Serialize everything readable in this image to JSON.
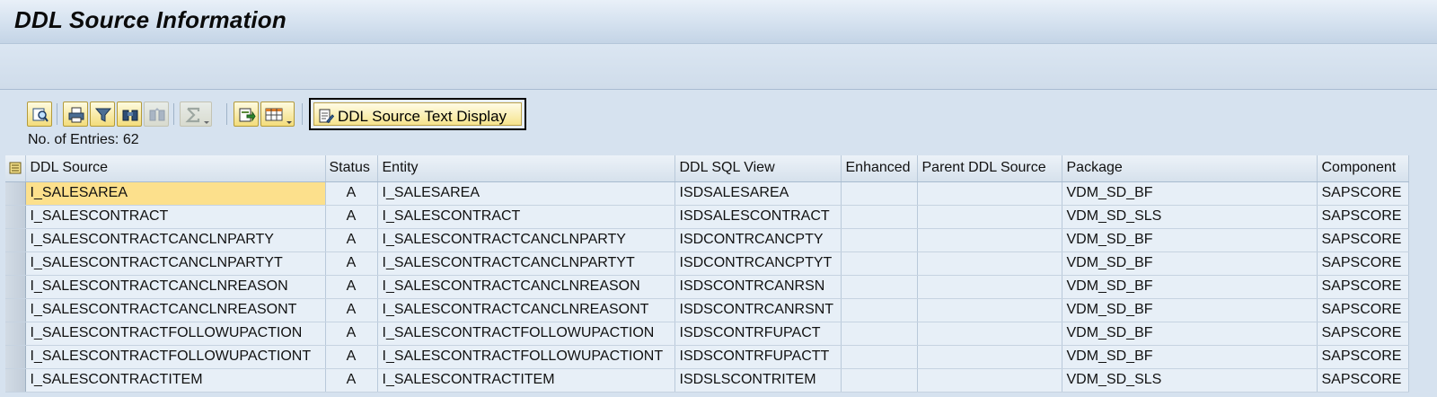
{
  "window": {
    "title": "DDL Source Information"
  },
  "toolbar": {
    "buttons": [
      {
        "name": "details-icon",
        "enabled": true
      },
      {
        "name": "print-icon",
        "enabled": true
      },
      {
        "name": "filter-icon",
        "enabled": true
      },
      {
        "name": "find-icon",
        "enabled": true
      },
      {
        "name": "find-next-icon",
        "enabled": false
      },
      {
        "name": "sum-icon",
        "enabled": false,
        "dropdown": true
      },
      {
        "name": "export-icon",
        "enabled": true
      },
      {
        "name": "layout-icon",
        "enabled": true,
        "dropdown": true
      }
    ],
    "text_button_label": "DDL Source Text Display"
  },
  "entries_label": "No. of Entries: 62",
  "table": {
    "columns": [
      "DDL Source",
      "Status",
      "Entity",
      "DDL SQL View",
      "Enhanced",
      "Parent DDL Source",
      "Package",
      "Component"
    ],
    "rows": [
      {
        "ddl": "I_SALESAREA",
        "status": "A",
        "entity": "I_SALESAREA",
        "view": "ISDSALESAREA",
        "enh": "",
        "parent": "",
        "pkg": "VDM_SD_BF",
        "comp": "SAPSCORE"
      },
      {
        "ddl": "I_SALESCONTRACT",
        "status": "A",
        "entity": "I_SALESCONTRACT",
        "view": "ISDSALESCONTRACT",
        "enh": "",
        "parent": "",
        "pkg": "VDM_SD_SLS",
        "comp": "SAPSCORE"
      },
      {
        "ddl": "I_SALESCONTRACTCANCLNPARTY",
        "status": "A",
        "entity": "I_SALESCONTRACTCANCLNPARTY",
        "view": "ISDCONTRCANCPTY",
        "enh": "",
        "parent": "",
        "pkg": "VDM_SD_BF",
        "comp": "SAPSCORE"
      },
      {
        "ddl": "I_SALESCONTRACTCANCLNPARTYT",
        "status": "A",
        "entity": "I_SALESCONTRACTCANCLNPARTYT",
        "view": "ISDCONTRCANCPTYT",
        "enh": "",
        "parent": "",
        "pkg": "VDM_SD_BF",
        "comp": "SAPSCORE"
      },
      {
        "ddl": "I_SALESCONTRACTCANCLNREASON",
        "status": "A",
        "entity": "I_SALESCONTRACTCANCLNREASON",
        "view": "ISDSCONTRCANRSN",
        "enh": "",
        "parent": "",
        "pkg": "VDM_SD_BF",
        "comp": "SAPSCORE"
      },
      {
        "ddl": "I_SALESCONTRACTCANCLNREASONT",
        "status": "A",
        "entity": "I_SALESCONTRACTCANCLNREASONT",
        "view": "ISDSCONTRCANRSNT",
        "enh": "",
        "parent": "",
        "pkg": "VDM_SD_BF",
        "comp": "SAPSCORE"
      },
      {
        "ddl": "I_SALESCONTRACTFOLLOWUPACTION",
        "status": "A",
        "entity": "I_SALESCONTRACTFOLLOWUPACTION",
        "view": "ISDSCONTRFUPACT",
        "enh": "",
        "parent": "",
        "pkg": "VDM_SD_BF",
        "comp": "SAPSCORE"
      },
      {
        "ddl": "I_SALESCONTRACTFOLLOWUPACTIONT",
        "status": "A",
        "entity": "I_SALESCONTRACTFOLLOWUPACTIONT",
        "view": "ISDSCONTRFUPACTT",
        "enh": "",
        "parent": "",
        "pkg": "VDM_SD_BF",
        "comp": "SAPSCORE"
      },
      {
        "ddl": "I_SALESCONTRACTITEM",
        "status": "A",
        "entity": "I_SALESCONTRACTITEM",
        "view": "ISDSLSCONTRITEM",
        "enh": "",
        "parent": "",
        "pkg": "VDM_SD_SLS",
        "comp": "SAPSCORE"
      }
    ],
    "selected_cell": {
      "row": 0,
      "column": "DDL Source"
    }
  },
  "colors": {
    "selected_cell": "#fce08c",
    "button_face": "#f3dc7a",
    "cell_bg": "#e7eff7"
  }
}
